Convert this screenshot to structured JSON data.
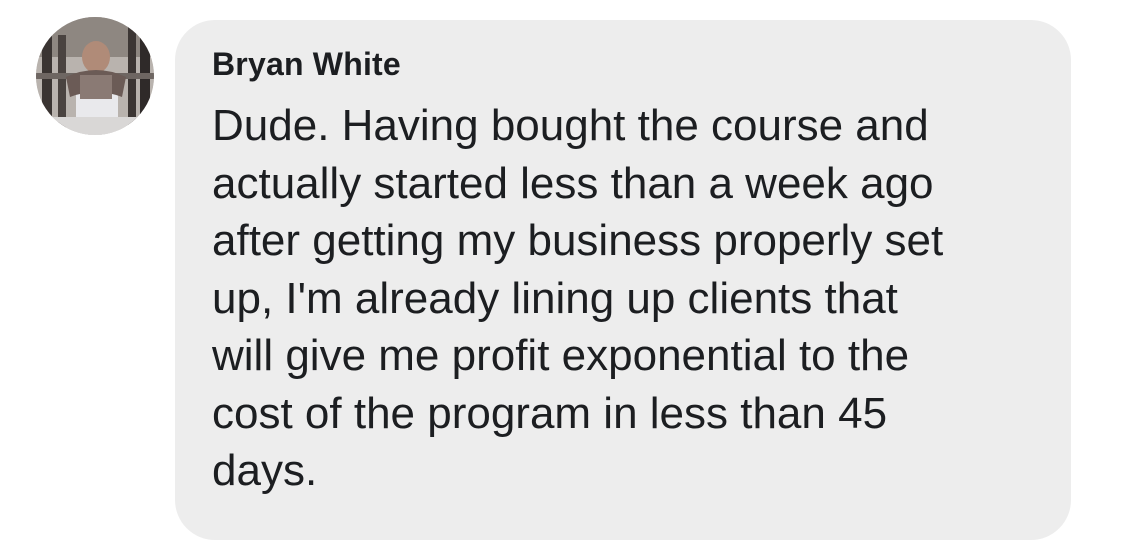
{
  "comment": {
    "author": "Bryan White",
    "avatar_icon": "profile-photo-avatar",
    "text_lines": [
      "Dude. Having bought the course and",
      "actually started less than a week ago",
      "after getting my business properly set",
      "up, I'm already lining up clients that",
      "will give me profit exponential to the",
      "cost of the program in less than 45",
      "days."
    ]
  },
  "colors": {
    "bubble_background": "#ededed",
    "text": "#1c1e21",
    "page_background": "#ffffff"
  }
}
